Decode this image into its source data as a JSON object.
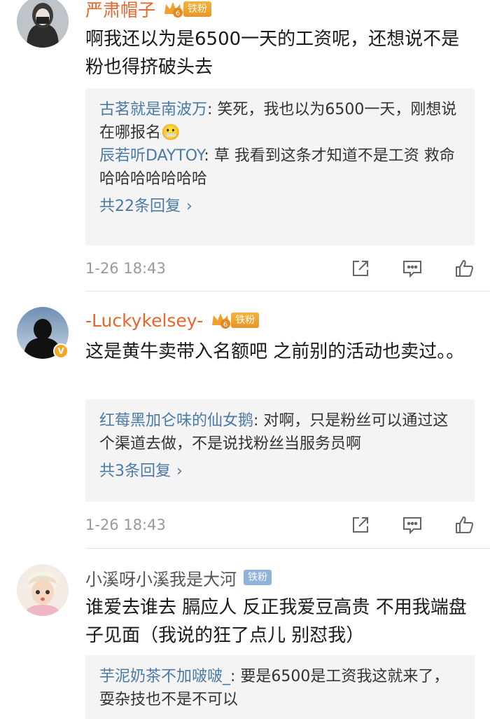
{
  "comments": [
    {
      "username": "严肃帽子",
      "fan_badge": "铁粉",
      "content": "啊我还以为是6500一天的工资呢，还想说不是粉也得挤破头去",
      "replies": [
        {
          "user": "古茗就是南波万",
          "text": "笑死，我也以为6500一天，刚想说在哪报名😬"
        },
        {
          "user": "辰若听DAYTOY",
          "text": "草 我看到这条才知道不是工资 救命哈哈哈哈哈哈哈"
        }
      ],
      "reply_count": "共22条回复",
      "timestamp": "1-26 18:43"
    },
    {
      "username": "-Luckykelsey-",
      "fan_badge": "铁粉",
      "content": "这是黄牛卖带入名额吧 之前别的活动也卖过。。",
      "replies": [
        {
          "user": "红莓黑加仑味的仙女鹅",
          "text": "对啊，只是粉丝可以通过这个渠道去做，不是说找粉丝当服务员啊"
        }
      ],
      "reply_count": "共3条回复",
      "timestamp": "1-26 18:43"
    },
    {
      "username": "小溪呀小溪我是大河",
      "fan_badge": "铁粉",
      "content": "谁爱去谁去 膈应人 反正我爱豆高贵 不用我端盘子见面（我说的狂了点儿 别怼我）",
      "replies": [
        {
          "user": "芋泥奶茶不加啵啵_",
          "text": "要是6500是工资我这就来了，耍杂技也不是不可以"
        }
      ]
    }
  ],
  "icons": {
    "share": "share-icon",
    "comment": "comment-icon",
    "like": "like-icon"
  },
  "colors": {
    "username_highlight": "#e8662a",
    "reply_user": "#4a7aa8",
    "reply_bg": "#f4f4f4",
    "meta_text": "#999999"
  }
}
